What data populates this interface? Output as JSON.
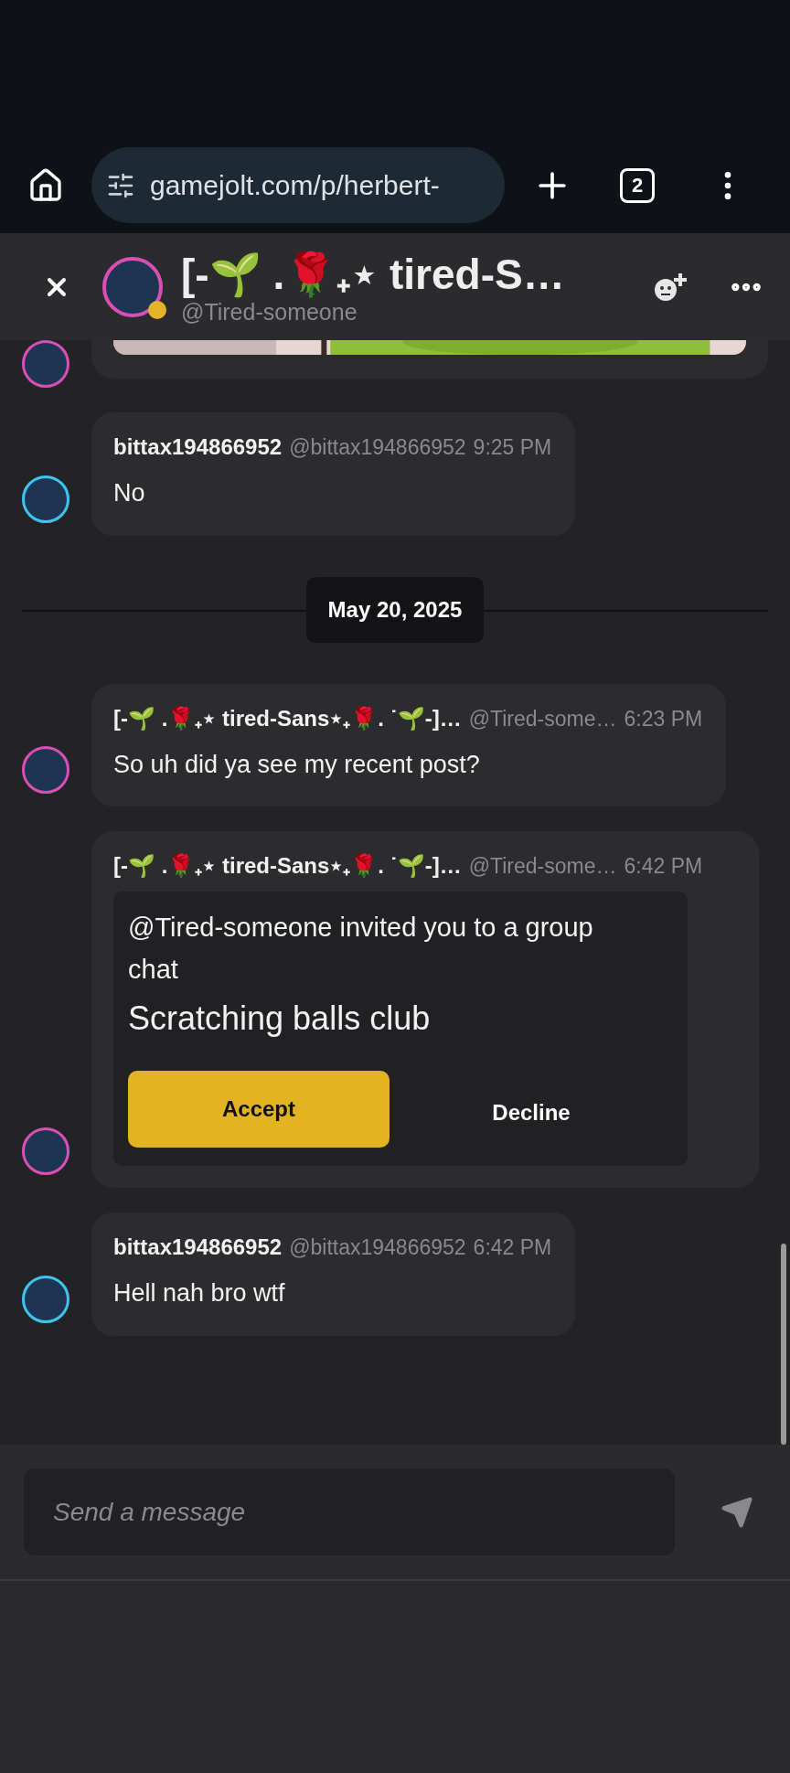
{
  "browser": {
    "url": "gamejolt.com/p/herbert-",
    "tab_count": "2"
  },
  "chat_header": {
    "title": "[-🌱 .🌹₊⋆ tired-S…",
    "handle": "@Tired-someone",
    "idle": true
  },
  "messages": [
    {
      "kind": "picture",
      "color": "#d94fb5"
    },
    {
      "kind": "text",
      "author": "bittax194866952",
      "handle": "@bittax194866952",
      "time": "9:25 PM",
      "text": "No",
      "color": "#3cc6ef"
    },
    {
      "kind": "date",
      "text": "May 20, 2025"
    },
    {
      "kind": "text",
      "author": "[-🌱 .🌹₊⋆ tired-Sans⋆₊🌹. ˙🌱-]…",
      "handle": "@Tired-some…",
      "time": "6:23 PM",
      "text": "So uh did ya see my recent post?",
      "color": "#d94fb5"
    },
    {
      "kind": "invite",
      "author": "[-🌱 .🌹₊⋆ tired-Sans⋆₊🌹. ˙🌱-]…",
      "handle": "@Tired-some…",
      "time": "6:42 PM",
      "invite_text": "@Tired-someone invited you to a group chat",
      "group_name": "Scratching balls club",
      "accept": "Accept",
      "decline": "Decline",
      "color": "#d94fb5"
    },
    {
      "kind": "text",
      "author": "bittax194866952",
      "handle": "@bittax194866952",
      "time": "6:42 PM",
      "text": "Hell nah bro wtf",
      "color": "#3cc6ef"
    }
  ],
  "composer": {
    "placeholder": "Send a message"
  }
}
